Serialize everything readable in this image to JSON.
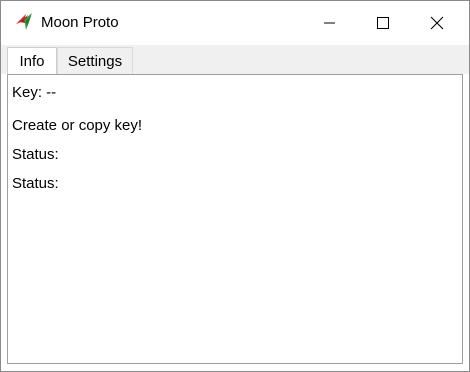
{
  "window": {
    "title": "Moon Proto",
    "icon": "moon-proto-app-icon"
  },
  "controls": {
    "minimize_icon": "minimize-icon",
    "maximize_icon": "maximize-icon",
    "close_icon": "close-icon"
  },
  "tabs": [
    {
      "label": "Info",
      "selected": true
    },
    {
      "label": "Settings",
      "selected": false
    }
  ],
  "info": {
    "key_text": "Key: --",
    "instruction": "Create or copy key!",
    "status_1": "Status:",
    "status_2": "Status:"
  },
  "colors": {
    "tab_strip": "#f0f0f0",
    "panel_border": "#a0a0a0",
    "icon_red": "#d9252c",
    "icon_green": "#2e9e3a"
  }
}
